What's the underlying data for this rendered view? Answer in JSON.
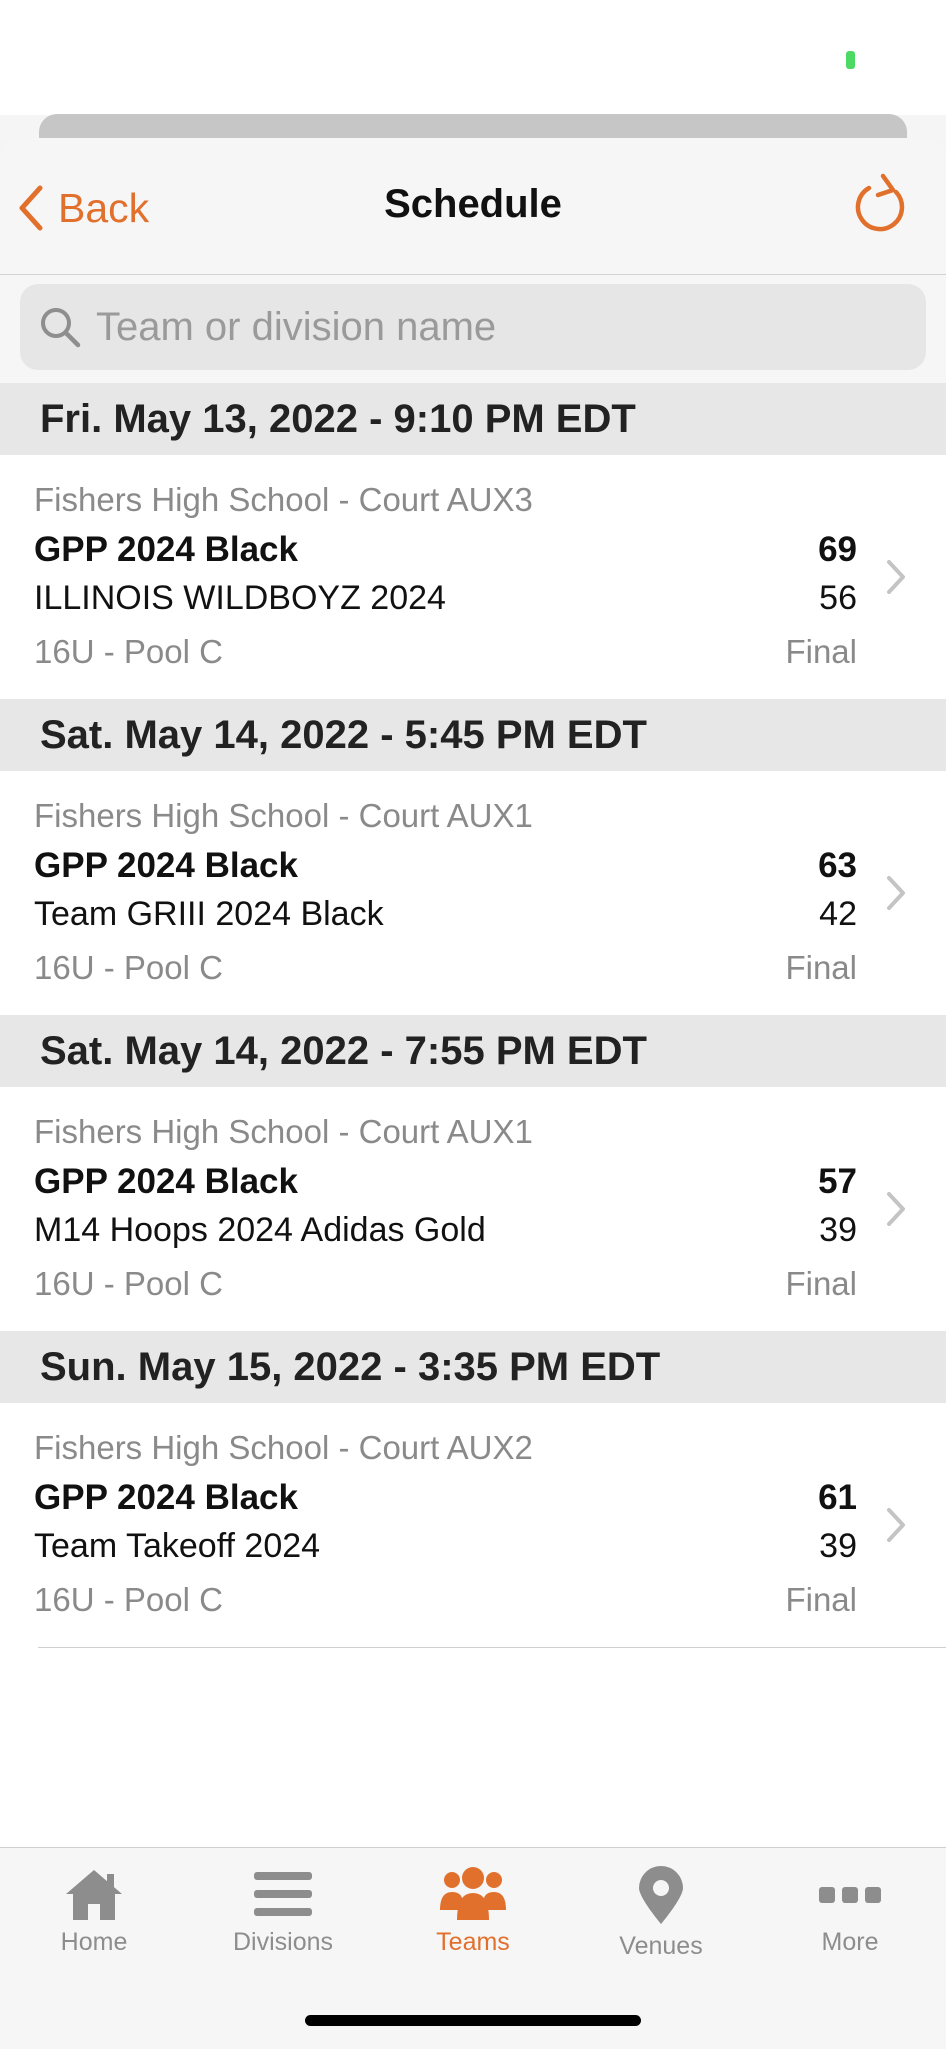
{
  "colors": {
    "accent": "#e2702d",
    "muted": "#8d8d8d",
    "section_bg": "#e7e7e7"
  },
  "nav": {
    "back_label": "Back",
    "title": "Schedule",
    "refresh_icon": "refresh-icon"
  },
  "search": {
    "placeholder": "Team or division name",
    "value": ""
  },
  "games": [
    {
      "date_header": "Fri. May 13, 2022 - 9:10 PM EDT",
      "venue": "Fishers High School - Court AUX3",
      "team1": "GPP 2024 Black",
      "score1": "69",
      "team2": "ILLINOIS WILDBOYZ 2024",
      "score2": "56",
      "division": "16U - Pool C",
      "status": "Final"
    },
    {
      "date_header": "Sat. May 14, 2022 - 5:45 PM EDT",
      "venue": "Fishers High School - Court AUX1",
      "team1": "GPP 2024 Black",
      "score1": "63",
      "team2": "Team GRIII 2024 Black",
      "score2": "42",
      "division": "16U - Pool C",
      "status": "Final"
    },
    {
      "date_header": "Sat. May 14, 2022 - 7:55 PM EDT",
      "venue": "Fishers High School - Court AUX1",
      "team1": "GPP 2024 Black",
      "score1": "57",
      "team2": "M14 Hoops 2024 Adidas Gold",
      "score2": "39",
      "division": "16U - Pool C",
      "status": "Final"
    },
    {
      "date_header": "Sun. May 15, 2022 - 3:35 PM EDT",
      "venue": "Fishers High School - Court AUX2",
      "team1": "GPP 2024 Black",
      "score1": "61",
      "team2": "Team Takeoff 2024",
      "score2": "39",
      "division": "16U - Pool C",
      "status": "Final"
    }
  ],
  "tabs": [
    {
      "label": "Home",
      "icon": "home-icon",
      "active": false
    },
    {
      "label": "Divisions",
      "icon": "list-icon",
      "active": false
    },
    {
      "label": "Teams",
      "icon": "team-icon",
      "active": true
    },
    {
      "label": "Venues",
      "icon": "location-pin-icon",
      "active": false
    },
    {
      "label": "More",
      "icon": "more-dots-icon",
      "active": false
    }
  ]
}
